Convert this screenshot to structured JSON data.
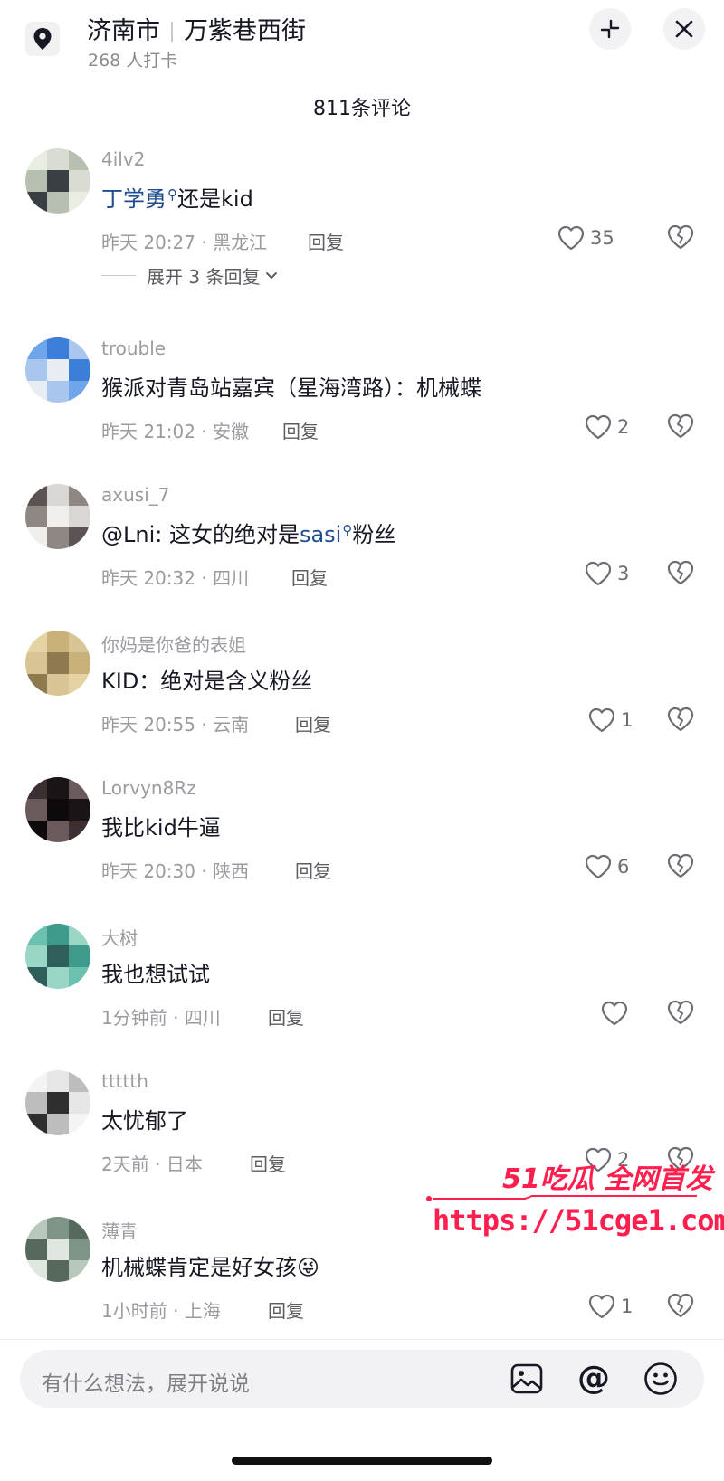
{
  "header": {
    "city": "济南市",
    "street": "万紫巷西街",
    "checkins": "268 人打卡"
  },
  "comment_count": "811条评论",
  "comments": [
    {
      "user": "4ilv2",
      "mention": "丁学勇",
      "text": "还是kid",
      "time": "昨天 20:27 · 黑龙江",
      "reply": "回复",
      "likes": "35",
      "avatar_colors": [
        "#d8dcd2",
        "#e9eee3",
        "#3a3f44",
        "#b7c0b0"
      ]
    },
    {
      "user": "trouble",
      "text": "猴派对青岛站嘉宾（星海湾路）：机械蝶",
      "time": "昨天 21:02 · 安徽",
      "reply": "回复",
      "likes": "2",
      "avatar_colors": [
        "#3d7fd8",
        "#6fa5ea",
        "#e8edf4",
        "#a8c6ee"
      ]
    },
    {
      "user": "axusi_7",
      "prefix": "@Lni: 这女的绝对是",
      "mention": "sasi",
      "text": "粉丝",
      "time": "昨天 20:32 · 四川",
      "reply": "回复",
      "likes": "3",
      "avatar_colors": [
        "#d9d6d4",
        "#5c5452",
        "#f1eeec",
        "#8f8784"
      ]
    },
    {
      "user": "你妈是你爸的表姐",
      "text": "KID：绝对是含义粉丝",
      "time": "昨天 20:55 · 云南",
      "reply": "回复",
      "likes": "1",
      "avatar_colors": [
        "#c9b27a",
        "#e5d3a4",
        "#8f7a4f",
        "#d9c495"
      ]
    },
    {
      "user": "Lorvyn8Rz",
      "text": "我比kid牛逼",
      "time": "昨天 20:30 · 陕西",
      "reply": "回复",
      "likes": "6",
      "avatar_colors": [
        "#1a1416",
        "#3b2f30",
        "#0e0a0b",
        "#6b5a5c"
      ]
    },
    {
      "user": "大树",
      "text": "我也想试试",
      "time": "1分钟前 · 四川",
      "reply": "回复",
      "likes": "",
      "avatar_colors": [
        "#3e9a8a",
        "#6cc0b0",
        "#2f5f5a",
        "#9ad6c6"
      ]
    },
    {
      "user": "ttttth",
      "text": "太忧郁了",
      "time": "2天前 · 日本",
      "reply": "回复",
      "likes": "2",
      "avatar_colors": [
        "#e6e6e6",
        "#f4f4f4",
        "#2e2e2e",
        "#bdbdbd"
      ]
    },
    {
      "user": "薄青",
      "text": "机械蝶肯定是好女孩",
      "emoji": "😜",
      "time": "1小时前 · 上海",
      "reply": "回复",
      "likes": "1",
      "avatar_colors": [
        "#7e9486",
        "#b9c8bc",
        "#dfe7e0",
        "#56695c"
      ]
    }
  ],
  "expand_replies": "展开 3 条回复",
  "watermark": {
    "title": "51吃瓜 全网首发",
    "url": "https://51cge1.com",
    "color": "#ff1f4e"
  },
  "input": {
    "placeholder": "有什么想法，展开说说"
  },
  "icons": {
    "location": "location-pin-icon",
    "collapse": "collapse-icon",
    "close": "close-icon",
    "like": "heart-icon",
    "dislike": "broken-heart-icon",
    "image": "image-icon",
    "mention": "at-icon",
    "emoji": "emoji-icon"
  }
}
